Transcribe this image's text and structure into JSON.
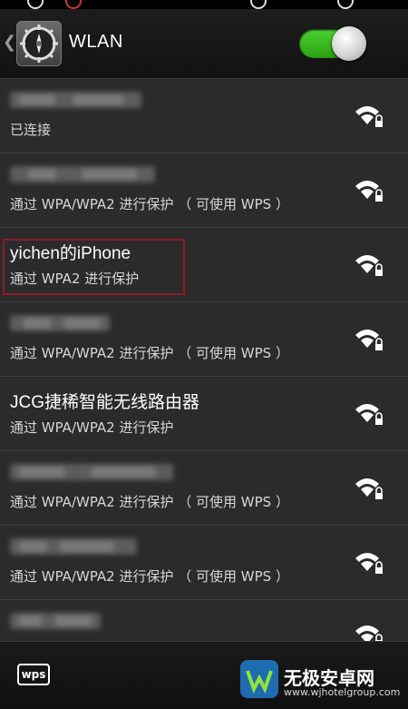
{
  "header": {
    "title": "WLAN"
  },
  "networks": [
    {
      "status": "已连接"
    },
    {
      "status": "通过 WPA/WPA2 进行保护 （ 可使用 WPS ）"
    },
    {
      "name": "yichen的iPhone",
      "status": "通过 WPA2 进行保护"
    },
    {
      "status": "通过 WPA/WPA2 进行保护 （ 可使用 WPS ）"
    },
    {
      "name": "JCG捷稀智能无线路由器",
      "status": "通过 WPA/WPA2 进行保护"
    },
    {
      "status": "通过 WPA/WPA2 进行保护 （ 可使用 WPS ）"
    },
    {
      "status": "通过 WPA/WPA2 进行保护 （ 可使用 WPS ）"
    },
    {
      "status": ""
    }
  ],
  "bottom": {
    "wps_label": "wps"
  },
  "watermark": {
    "name": "无极安卓网",
    "url": "www.wjhotelgroup.com"
  },
  "colors": {
    "toggle_on": "#3fc324",
    "highlight": "#8e1b2c",
    "background": "#2b2b2b"
  }
}
